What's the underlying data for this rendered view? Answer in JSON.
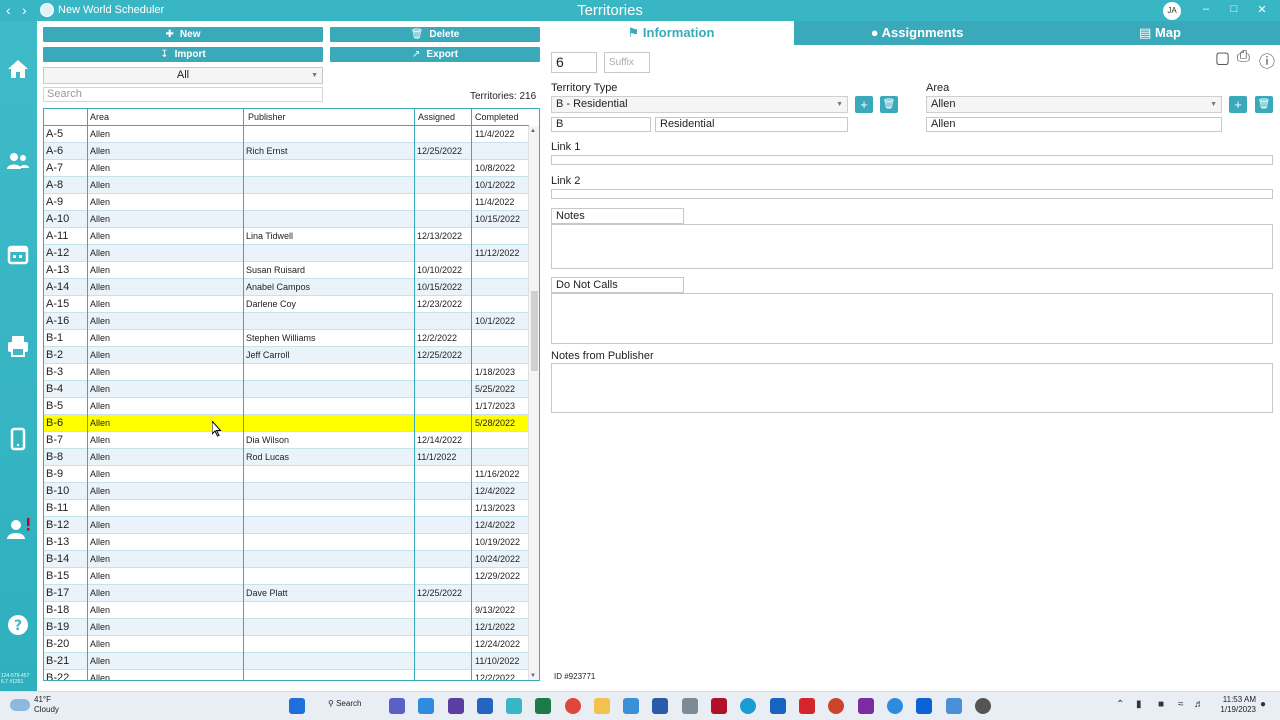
{
  "titlebar": {
    "app_name": "New World Scheduler",
    "window_title": "Territories",
    "user_initials": "JA"
  },
  "toolbar": {
    "new_label": "New",
    "delete_label": "Delete",
    "import_label": "Import",
    "export_label": "Export"
  },
  "filter": {
    "selected": "All"
  },
  "search": {
    "placeholder": "Search"
  },
  "count_label": "Territories: 216",
  "table": {
    "headers": [
      "",
      "Area",
      "Publisher",
      "Assigned",
      "Completed"
    ],
    "rows": [
      [
        "A-5",
        "Allen",
        "",
        "",
        "11/4/2022"
      ],
      [
        "A-6",
        "Allen",
        "Rich Ernst",
        "12/25/2022",
        ""
      ],
      [
        "A-7",
        "Allen",
        "",
        "",
        "10/8/2022"
      ],
      [
        "A-8",
        "Allen",
        "",
        "",
        "10/1/2022"
      ],
      [
        "A-9",
        "Allen",
        "",
        "",
        "11/4/2022"
      ],
      [
        "A-10",
        "Allen",
        "",
        "",
        "10/15/2022"
      ],
      [
        "A-11",
        "Allen",
        "Lina Tidwell",
        "12/13/2022",
        ""
      ],
      [
        "A-12",
        "Allen",
        "",
        "",
        "11/12/2022"
      ],
      [
        "A-13",
        "Allen",
        "Susan Ruisard",
        "10/10/2022",
        ""
      ],
      [
        "A-14",
        "Allen",
        "Anabel Campos",
        "10/15/2022",
        ""
      ],
      [
        "A-15",
        "Allen",
        "Darlene Coy",
        "12/23/2022",
        ""
      ],
      [
        "A-16",
        "Allen",
        "",
        "",
        "10/1/2022"
      ],
      [
        "B-1",
        "Allen",
        "Stephen Williams",
        "12/2/2022",
        ""
      ],
      [
        "B-2",
        "Allen",
        "Jeff Carroll",
        "12/25/2022",
        ""
      ],
      [
        "B-3",
        "Allen",
        "",
        "",
        "1/18/2023"
      ],
      [
        "B-4",
        "Allen",
        "",
        "",
        "5/25/2022"
      ],
      [
        "B-5",
        "Allen",
        "",
        "",
        "1/17/2023"
      ],
      [
        "B-6",
        "Allen",
        "",
        "",
        "5/28/2022"
      ],
      [
        "B-7",
        "Allen",
        "Dia Wilson",
        "12/14/2022",
        ""
      ],
      [
        "B-8",
        "Allen",
        "Rod Lucas",
        "11/1/2022",
        ""
      ],
      [
        "B-9",
        "Allen",
        "",
        "",
        "11/16/2022"
      ],
      [
        "B-10",
        "Allen",
        "",
        "",
        "12/4/2022"
      ],
      [
        "B-11",
        "Allen",
        "",
        "",
        "1/13/2023"
      ],
      [
        "B-12",
        "Allen",
        "",
        "",
        "12/4/2022"
      ],
      [
        "B-13",
        "Allen",
        "",
        "",
        "10/19/2022"
      ],
      [
        "B-14",
        "Allen",
        "",
        "",
        "10/24/2022"
      ],
      [
        "B-15",
        "Allen",
        "",
        "",
        "12/29/2022"
      ],
      [
        "B-17",
        "Allen",
        "Dave Platt",
        "12/25/2022",
        ""
      ],
      [
        "B-18",
        "Allen",
        "",
        "",
        "9/13/2022"
      ],
      [
        "B-19",
        "Allen",
        "",
        "",
        "12/1/2022"
      ],
      [
        "B-20",
        "Allen",
        "",
        "",
        "12/24/2022"
      ],
      [
        "B-21",
        "Allen",
        "",
        "",
        "11/10/2022"
      ],
      [
        "B-22",
        "Allen",
        "",
        "",
        "12/2/2022"
      ]
    ],
    "selected_index": 17
  },
  "tabs": {
    "information": "Information",
    "assignments": "Assignments",
    "map": "Map"
  },
  "info": {
    "number": "6",
    "suffix_placeholder": "Suffix",
    "territory_type_label": "Territory Type",
    "territory_type_value": "B - Residential",
    "type_code": "B",
    "type_name": "Residential",
    "area_label": "Area",
    "area_value": "Allen",
    "area_name": "Allen",
    "link1_label": "Link 1",
    "link2_label": "Link 2",
    "notes_label": "Notes",
    "do_not_calls_label": "Do Not Calls",
    "notes_from_publisher_label": "Notes from Publisher",
    "id_label": "ID #923771"
  },
  "sidebar": {
    "version": "124-579-457 6.7 #1261"
  },
  "taskbar": {
    "temperature": "41°F",
    "condition": "Cloudy",
    "search_label": "Search",
    "time": "11:53 AM",
    "date": "1/19/2023"
  },
  "colors": {
    "accent": "#3aa9ba",
    "titlebar": "#39b6c4",
    "selected_row": "#ffff00",
    "alt_row": "#eaf3fa"
  }
}
